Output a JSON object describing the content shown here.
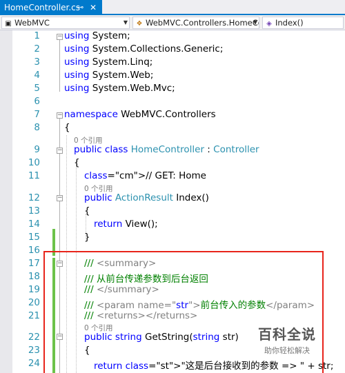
{
  "tab": {
    "title": "HomeController.cs",
    "pin_icon": "pin-icon",
    "close_icon": "close-icon"
  },
  "navbar": {
    "project": "WebMVC",
    "type": "WebMVC.Controllers.HomeCo",
    "member": "Index()"
  },
  "lines": [
    {
      "n": "1",
      "t": "using System;"
    },
    {
      "n": "2",
      "t": "using System.Collections.Generic;"
    },
    {
      "n": "3",
      "t": "using System.Linq;"
    },
    {
      "n": "4",
      "t": "using System.Web;"
    },
    {
      "n": "5",
      "t": "using System.Web.Mvc;"
    },
    {
      "n": "6",
      "t": ""
    },
    {
      "n": "7",
      "t": "namespace WebMVC.Controllers"
    },
    {
      "n": "8",
      "t": "{"
    },
    {
      "n": "9",
      "t": "public class HomeController : Controller"
    },
    {
      "n": "10",
      "t": "{"
    },
    {
      "n": "11",
      "t": "// GET: Home"
    },
    {
      "n": "12",
      "t": "public ActionResult Index()"
    },
    {
      "n": "13",
      "t": "{"
    },
    {
      "n": "14",
      "t": "return View();"
    },
    {
      "n": "15",
      "t": "}"
    },
    {
      "n": "16",
      "t": ""
    },
    {
      "n": "17",
      "t": "/// <summary>"
    },
    {
      "n": "18",
      "t": "/// 从前台传递参数到后台返回"
    },
    {
      "n": "19",
      "t": "/// </summary>"
    },
    {
      "n": "20",
      "t": "/// <param name=\"str\">前台传入的参数</param>"
    },
    {
      "n": "21",
      "t": "/// <returns></returns>"
    },
    {
      "n": "22",
      "t": "public string GetString(string str)"
    },
    {
      "n": "23",
      "t": "{"
    },
    {
      "n": "24",
      "t": "return \"这是后台接收到的参数 => \" + str;"
    }
  ],
  "refs": {
    "r1": "0 个引用",
    "r2": "0 个引用",
    "r3": "0 个引用"
  },
  "watermark": {
    "title": "百科全说",
    "subtitle": "助你轻松解决"
  },
  "colors": {
    "keyword": "#0000ff",
    "type": "#2b91af",
    "comment": "#008000",
    "string": "#a31515",
    "highlight_box": "#e8231a",
    "tab_accent": "#007acc"
  }
}
